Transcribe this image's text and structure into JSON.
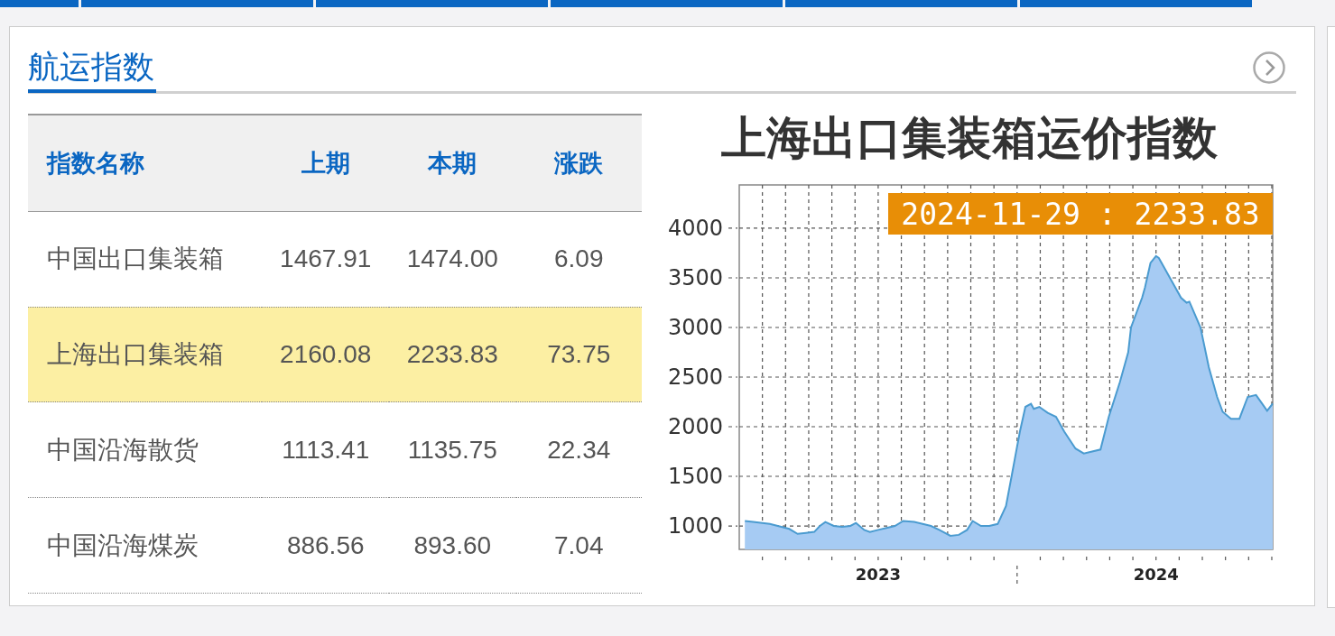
{
  "nav_tabs": [
    {
      "selected": false
    },
    {
      "selected": false
    },
    {
      "selected": false
    },
    {
      "selected": false
    },
    {
      "selected": false
    },
    {
      "selected": false
    }
  ],
  "panel": {
    "title": "航运指数"
  },
  "table": {
    "columns": [
      "指数名称",
      "上期",
      "本期",
      "涨跌"
    ],
    "rows": [
      {
        "cells": [
          "中国出口集装箱",
          "1467.91",
          "1474.00",
          "6.09"
        ],
        "selected": false
      },
      {
        "cells": [
          "上海出口集装箱",
          "2160.08",
          "2233.83",
          "73.75"
        ],
        "selected": true
      },
      {
        "cells": [
          "中国沿海散货",
          "1113.41",
          "1135.75",
          "22.34"
        ],
        "selected": false
      },
      {
        "cells": [
          "中国沿海煤炭",
          "886.56",
          "893.60",
          "7.04"
        ],
        "selected": false
      }
    ]
  },
  "chart_data": {
    "type": "area",
    "title": "上海出口集装箱运价指数",
    "x": [
      2023.02,
      2023.05,
      2023.11,
      2023.18,
      2023.21,
      2023.24,
      2023.27,
      2023.29,
      2023.31,
      2023.34,
      2023.37,
      2023.4,
      2023.42,
      2023.45,
      2023.47,
      2023.5,
      2023.53,
      2023.56,
      2023.59,
      2023.63,
      2023.66,
      2023.69,
      2023.72,
      2023.76,
      2023.79,
      2023.82,
      2023.84,
      2023.87,
      2023.9,
      2023.93,
      2023.96,
      2023.98,
      2024.0,
      2024.01,
      2024.03,
      2024.05,
      2024.06,
      2024.08,
      2024.11,
      2024.14,
      2024.17,
      2024.21,
      2024.24,
      2024.27,
      2024.3,
      2024.33,
      2024.37,
      2024.4,
      2024.41,
      2024.45,
      2024.46,
      2024.48,
      2024.5,
      2024.51,
      2024.53,
      2024.56,
      2024.59,
      2024.61,
      2024.62,
      2024.66,
      2024.69,
      2024.72,
      2024.74,
      2024.77,
      2024.8,
      2024.83,
      2024.86,
      2024.88,
      2024.9,
      2024.92
    ],
    "grid": true,
    "series": [
      {
        "color": "#4a9bd0",
        "values": [
          1050,
          1040,
          1020,
          970,
          920,
          930,
          940,
          1000,
          1040,
          1000,
          990,
          1000,
          1030,
          960,
          940,
          960,
          980,
          1000,
          1050,
          1040,
          1020,
          1000,
          960,
          900,
          910,
          960,
          1050,
          1000,
          1000,
          1020,
          1200,
          1500,
          1800,
          1950,
          2200,
          2230,
          2180,
          2200,
          2140,
          2100,
          1950,
          1780,
          1730,
          1750,
          1770,
          2100,
          2450,
          2750,
          3000,
          3300,
          3400,
          3650,
          3720,
          3700,
          3600,
          3450,
          3300,
          3250,
          3260,
          3000,
          2600,
          2300,
          2150,
          2080,
          2080,
          2300,
          2320,
          2240,
          2160,
          2233.83
        ]
      }
    ],
    "xlim": [
      2023.0,
      2024.92
    ],
    "ylim": [
      764,
      4436
    ],
    "xticks": [
      {
        "value": 2023.5,
        "label": "2023"
      },
      {
        "value": 2024.5,
        "label": "2024"
      }
    ],
    "yticks": [
      1000,
      1500,
      2000,
      2500,
      3000,
      3500,
      4000
    ],
    "annotations": [
      {
        "text": "2024-11-29 : 2233.83"
      }
    ]
  }
}
